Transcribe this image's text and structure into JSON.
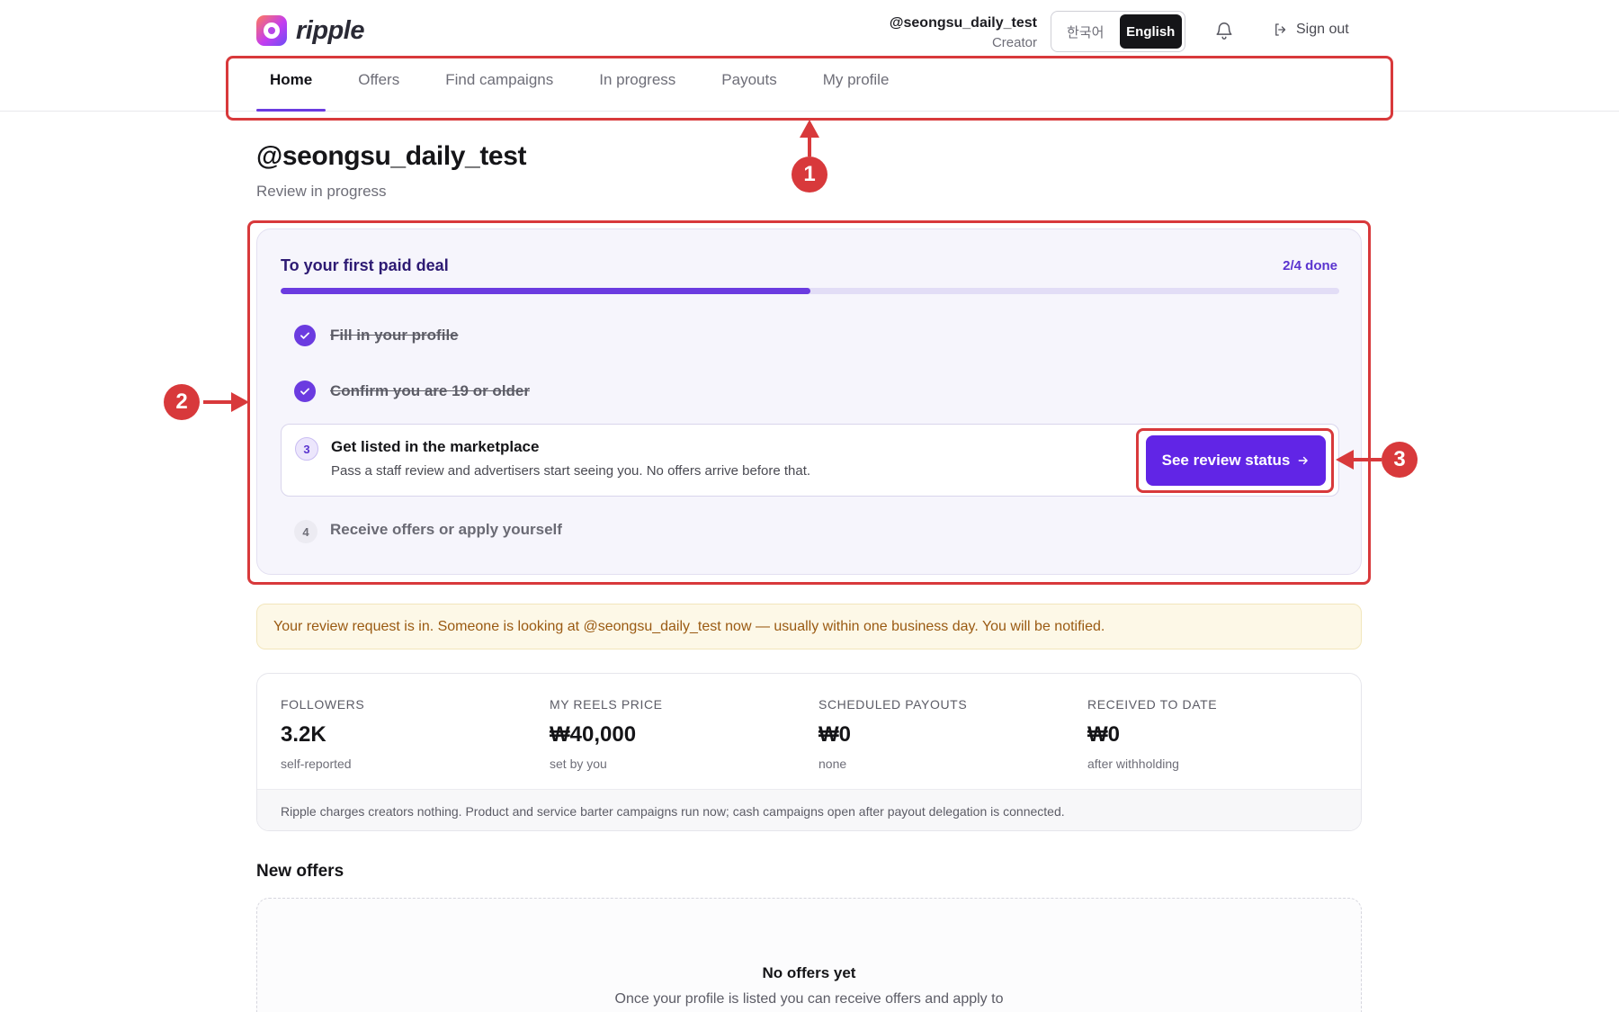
{
  "app": {
    "brand": "ripple"
  },
  "header": {
    "user_handle": "@seongsu_daily_test",
    "user_role": "Creator",
    "languages": [
      "한국어",
      "English"
    ],
    "active_language": "English",
    "signout_label": "Sign out",
    "icons": {
      "notifications": "bell-icon",
      "signout": "sign-out-icon"
    }
  },
  "nav": {
    "tabs": [
      {
        "label": "Home",
        "active": true
      },
      {
        "label": "Offers",
        "active": false
      },
      {
        "label": "Find campaigns",
        "active": false
      },
      {
        "label": "In progress",
        "active": false
      },
      {
        "label": "Payouts",
        "active": false
      },
      {
        "label": "My profile",
        "active": false
      }
    ]
  },
  "page": {
    "title": "@seongsu_daily_test",
    "subtitle": "Review in progress"
  },
  "steps": {
    "title": "To your first paid deal",
    "count_label": "2/4 done",
    "progress_fraction": 0.5,
    "items": [
      {
        "number": "1",
        "label": "Fill in your profile",
        "status": "done"
      },
      {
        "number": "2",
        "label": "Confirm you are 19 or older",
        "status": "done"
      },
      {
        "number": "3",
        "label": "Get listed in the marketplace",
        "description": "Pass a staff review and advertisers start seeing you. No offers arrive before that.",
        "status": "active",
        "button_label": "See review status"
      },
      {
        "number": "4",
        "label": "Receive offers or apply yourself",
        "status": "todo"
      }
    ]
  },
  "notice": {
    "text": "Your review request is in. Someone is looking at @seongsu_daily_test now — usually within one business day. You will be notified."
  },
  "stats": {
    "items": [
      {
        "label": "FOLLOWERS",
        "value": "3.2K",
        "note": "self-reported"
      },
      {
        "label": "MY REELS PRICE",
        "value": "₩40,000",
        "note": "set by you"
      },
      {
        "label": "SCHEDULED PAYOUTS",
        "value": "₩0",
        "note": "none"
      },
      {
        "label": "RECEIVED TO DATE",
        "value": "₩0",
        "note": "after withholding"
      }
    ],
    "footer": "Ripple charges creators nothing. Product and service barter campaigns run now; cash campaigns open after payout delegation is connected."
  },
  "offers": {
    "section_title": "New offers",
    "empty_title": "No offers yet",
    "empty_desc": "Once your profile is listed you can receive offers and apply to"
  },
  "annotations": {
    "labels": [
      "1",
      "2",
      "3"
    ],
    "color": "#d8393b"
  },
  "colors": {
    "accent": "#6b3be0",
    "button": "#6125e6",
    "notice_text": "#9a5a12",
    "notice_bg": "#fdf8e7"
  }
}
